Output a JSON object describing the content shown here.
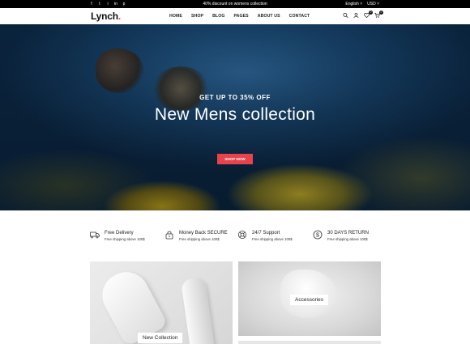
{
  "topbar": {
    "social": [
      "f",
      "t",
      "i",
      "in",
      "p"
    ],
    "promo": "40% discount on womens collection",
    "language": "English",
    "currency": "USD"
  },
  "header": {
    "logo_text": "Lynch",
    "logo_dot": ".",
    "nav": [
      "HOME",
      "SHOP",
      "BLOG",
      "PAGES",
      "ABOUT US",
      "CONTACT"
    ],
    "active_nav": "HOME",
    "wishlist_count": "0",
    "cart_count": "0"
  },
  "hero": {
    "subtitle": "GET UP TO 35% OFF",
    "title": "New Mens collection",
    "button": "SHOP NOW"
  },
  "features": [
    {
      "icon": "truck-icon",
      "title": "Free Delivery",
      "desc": "Free shipping above 100$"
    },
    {
      "icon": "lock-icon",
      "title": "Money Back SECURE",
      "desc": "Free shipping above 100$"
    },
    {
      "icon": "support-icon",
      "title": "24/7 Support",
      "desc": "Free shipping above 100$"
    },
    {
      "icon": "dollar-icon",
      "title": "30 DAYS RETURN",
      "desc": "Free shipping above 100$"
    }
  ],
  "categories": {
    "men": "New Collection",
    "accessories": "Accessories"
  },
  "colors": {
    "accent": "#e8434d",
    "topbar": "#000000"
  }
}
